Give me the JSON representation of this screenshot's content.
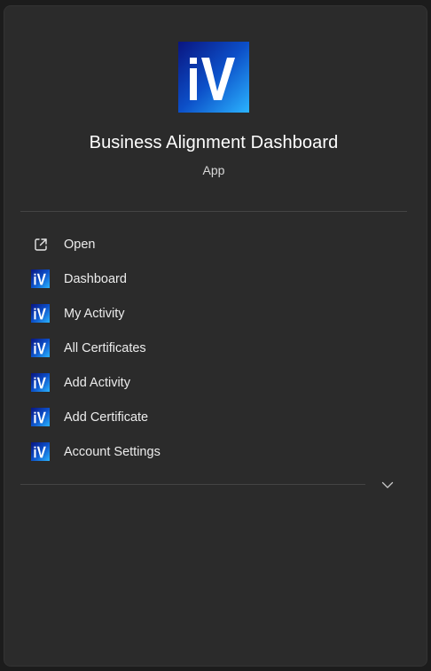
{
  "app": {
    "name": "Business Alignment Dashboard",
    "type": "App",
    "logo_text": "iV"
  },
  "menu": {
    "items": [
      {
        "label": "Open",
        "icon": "open-external-icon"
      },
      {
        "label": "Dashboard",
        "icon": "iv-app-icon"
      },
      {
        "label": "My Activity",
        "icon": "iv-app-icon"
      },
      {
        "label": "All Certificates",
        "icon": "iv-app-icon"
      },
      {
        "label": "Add Activity",
        "icon": "iv-app-icon"
      },
      {
        "label": "Add Certificate",
        "icon": "iv-app-icon"
      },
      {
        "label": "Account Settings",
        "icon": "iv-app-icon"
      }
    ]
  },
  "footer": {
    "expand_icon": "chevron-down-icon"
  },
  "colors": {
    "panel_background": "#2b2b2b",
    "logo_gradient_dark": "#0b1a8c",
    "logo_gradient_light": "#1fa2ff",
    "text_primary": "#ffffff",
    "divider": "#444444"
  }
}
